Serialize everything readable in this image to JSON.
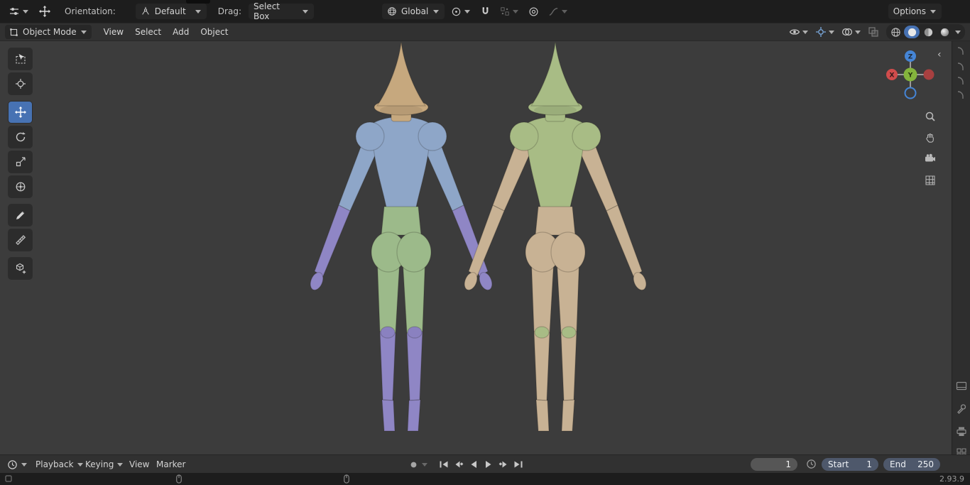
{
  "colors": {
    "accent": "#4772b3",
    "topbar_bg": "#1d1d1d",
    "header_bg": "#313131",
    "viewport_bg": "#3c3c3c",
    "field_bg": "#565656",
    "range_field_bg": "#4e586b",
    "axis_x": "#d04c4c",
    "axis_x_dark": "#a84040",
    "axis_y": "#84b43c",
    "axis_z": "#4585d6"
  },
  "topbar": {
    "orientation_label": "Orientation:",
    "orientation_value": "Default",
    "drag_label": "Drag:",
    "drag_value": "Select Box",
    "transform_orientation_value": "Global",
    "options_label": "Options"
  },
  "viewport_header": {
    "mode_value": "Object Mode",
    "menus": [
      {
        "label": "View"
      },
      {
        "label": "Select"
      },
      {
        "label": "Add"
      },
      {
        "label": "Object"
      }
    ]
  },
  "tools": [
    {
      "name": "select-box",
      "active": false
    },
    {
      "name": "cursor",
      "active": false
    },
    {
      "name": "move",
      "active": true
    },
    {
      "name": "rotate",
      "active": false
    },
    {
      "name": "scale",
      "active": false
    },
    {
      "name": "transform",
      "active": false
    },
    {
      "name": "annotate",
      "active": false
    },
    {
      "name": "measure",
      "active": false
    },
    {
      "name": "add-cube",
      "active": false
    }
  ],
  "gizmo": {
    "x_label": "X",
    "y_label": "Y",
    "z_label": "Z"
  },
  "shading_modes": [
    "wireframe",
    "solid",
    "material-preview",
    "rendered"
  ],
  "active_shading_mode": "solid",
  "timeline": {
    "playback_label": "Playback",
    "keying_label": "Keying",
    "view_label": "View",
    "marker_label": "Marker",
    "current_frame": "1",
    "start_label": "Start",
    "start_value": "1",
    "end_label": "End",
    "end_value": "250"
  },
  "statusbar": {
    "version": "2.93.9"
  },
  "models": {
    "left": {
      "hat": "#c6a87e",
      "torso": "#8ea6c8",
      "waist": "#9cba8a",
      "hips": "#9cba8a",
      "upperarm": "#8ea6c8",
      "forearm": "#8f86c5",
      "thigh": "#9cba8a",
      "shin": "#8f86c5",
      "trim": "#8a81c0"
    },
    "right": {
      "hat": "#a8bc85",
      "torso": "#a8bc85",
      "waist": "#c8b294",
      "hips": "#c8b294",
      "upperarm": "#c8b294",
      "forearm": "#c8b294",
      "thigh": "#c8b294",
      "shin": "#c8b294",
      "trim": "#a8bc85"
    }
  },
  "icons": {
    "editor-type": "tool-sliders",
    "move-tool": "cross-arrows",
    "orientation": "axis-tripod",
    "global": "globe",
    "pivot-point": "circle-dot",
    "magnet": "magnet-u",
    "snap-settings": "grid-dots",
    "proportional-editing": "concentric-circles",
    "falloff-curve": "s-curve",
    "visibility": "eye",
    "gizmos": "crosshair-circle",
    "overlays": "two-circles",
    "xray": "overlapping-squares",
    "shading": [
      "wireframe-sphere",
      "solid-sphere",
      "material-sphere",
      "rendered-sphere"
    ],
    "nav-side": [
      "magnifier",
      "pan-hand",
      "camera",
      "grid"
    ],
    "transport": [
      "jump-to-start",
      "prev-keyframe",
      "play-reverse",
      "play",
      "next-keyframe",
      "jump-to-end"
    ],
    "timeline-editor": "clock",
    "auto-keying": "record-dot"
  }
}
